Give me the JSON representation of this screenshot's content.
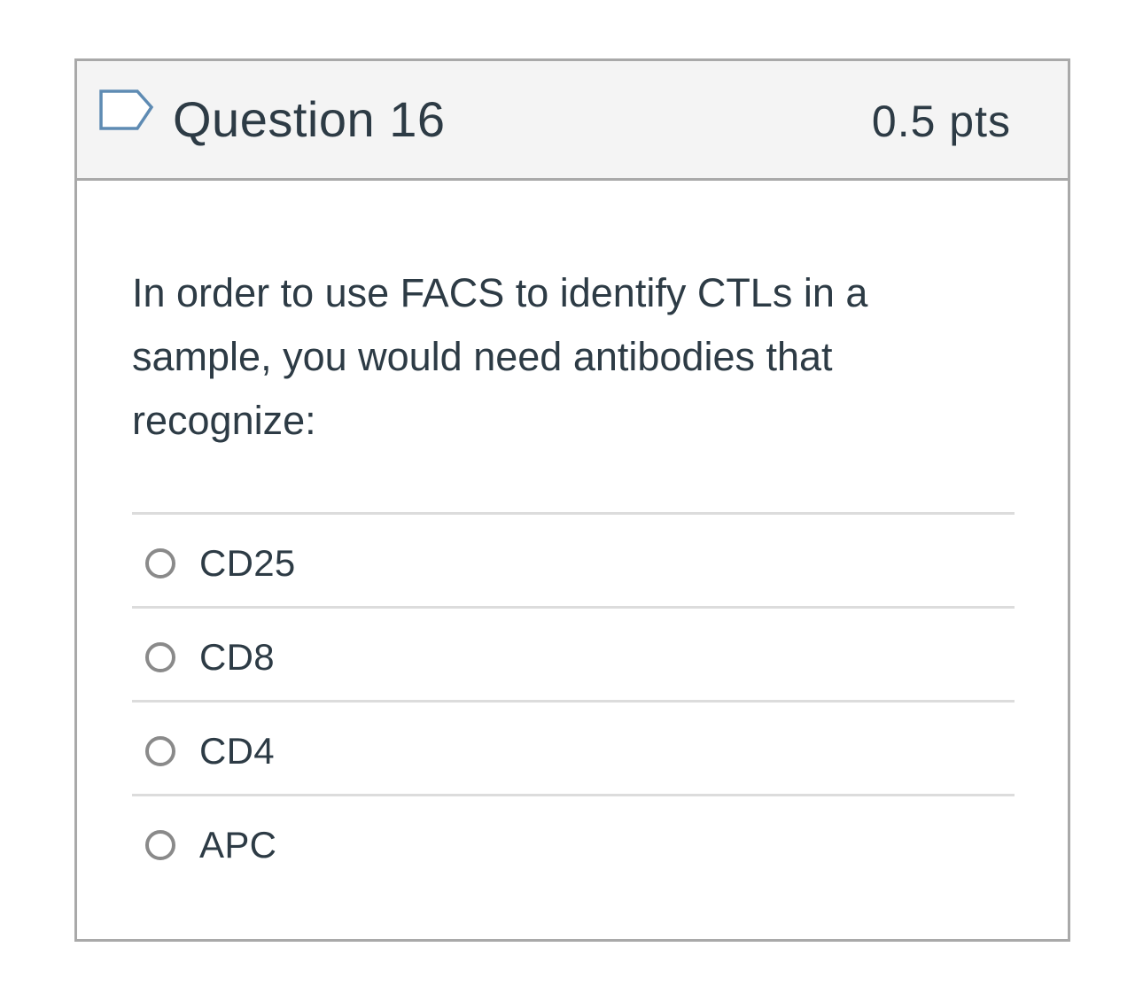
{
  "question": {
    "title": "Question 16",
    "points": "0.5 pts",
    "flag_icon": "flag-question-icon",
    "text": "In order to use FACS to identify CTLs in a sample, you would need antibodies that recognize:",
    "answers": [
      {
        "label": "CD25",
        "selected": false
      },
      {
        "label": "CD8",
        "selected": false
      },
      {
        "label": "CD4",
        "selected": false
      },
      {
        "label": "APC",
        "selected": false
      }
    ]
  },
  "colors": {
    "text": "#2d3b45",
    "header_bg": "#f4f4f4",
    "border": "#a9a9a9",
    "divider": "#dcdcdc",
    "flag": "#5e8bb3",
    "radio": "#8a8a8a"
  }
}
